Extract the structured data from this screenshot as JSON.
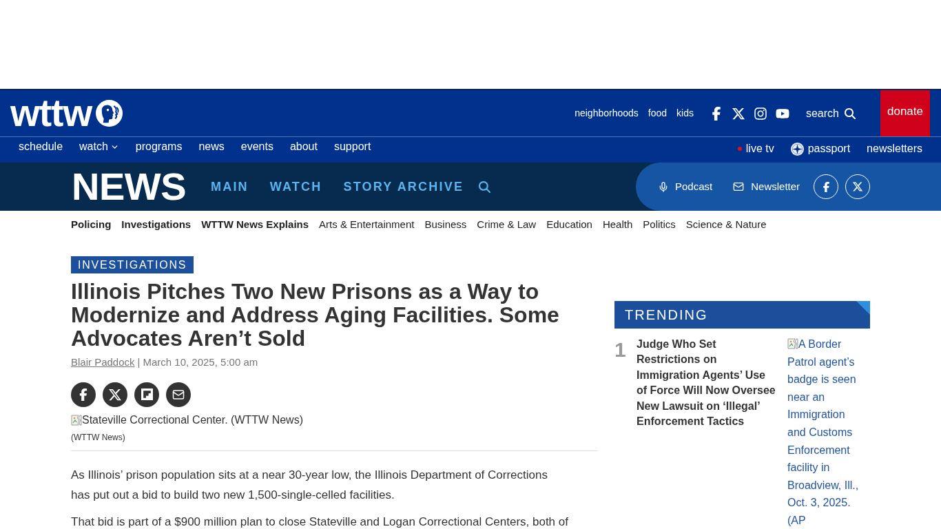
{
  "header": {
    "logo": "wttw",
    "top_links": [
      "neighborhoods",
      "food",
      "kids"
    ],
    "search": "search",
    "donate": "donate",
    "nav": [
      {
        "label": "schedule",
        "dropdown": false
      },
      {
        "label": "watch",
        "dropdown": true
      },
      {
        "label": "programs",
        "dropdown": false
      },
      {
        "label": "news",
        "dropdown": false
      },
      {
        "label": "events",
        "dropdown": false
      },
      {
        "label": "about",
        "dropdown": false
      },
      {
        "label": "support",
        "dropdown": false
      }
    ],
    "utility_links": [
      {
        "label": "live tv",
        "kind": "live"
      },
      {
        "label": "passport",
        "kind": "passport"
      },
      {
        "label": "newsletters",
        "kind": "plain"
      }
    ]
  },
  "news_bar": {
    "logo": "NEWS",
    "links": [
      "MAIN",
      "WATCH",
      "STORY ARCHIVE"
    ],
    "actions": [
      {
        "label": "Podcast",
        "kind": "podcast"
      },
      {
        "label": "Newsletter",
        "kind": "newsletter"
      }
    ]
  },
  "categories": [
    {
      "label": "Policing",
      "emphasized": true
    },
    {
      "label": "Investigations",
      "emphasized": true
    },
    {
      "label": "WTTW News Explains",
      "emphasized": true
    },
    {
      "label": "Arts & Entertainment",
      "emphasized": false
    },
    {
      "label": "Business",
      "emphasized": false
    },
    {
      "label": "Crime & Law",
      "emphasized": false
    },
    {
      "label": "Education",
      "emphasized": false
    },
    {
      "label": "Health",
      "emphasized": false
    },
    {
      "label": "Politics",
      "emphasized": false
    },
    {
      "label": "Science & Nature",
      "emphasized": false
    }
  ],
  "article": {
    "section": "INVESTIGATIONS",
    "headline": "Illinois Pitches Two New Prisons as a Way to Modernize and Address Aging Facilities. Some Advocates Aren’t Sold",
    "author": "Blair Paddock",
    "separator": "|",
    "date": "March 10, 2025, 5:00 am",
    "image_alt": "Stateville Correctional Center. (WTTW News)",
    "image_credit": "(WTTW News)",
    "paragraphs": [
      "As Illinois’ prison population sits at a near 30-year low, the Illinois Department of Corrections has put out a bid to build two new 1,500-single-celled facilities.",
      "That bid is part of a $900 million plan to close Stateville and Logan Correctional Centers, both of"
    ]
  },
  "trending": {
    "title": "TRENDING",
    "items": [
      {
        "rank": "1",
        "title": "Judge Who Set Restrictions on Immigration Agents’ Use of Force Will Now Oversee New Lawsuit on ‘Illegal’ Enforcement Tactics",
        "image_alt": "A Border Patrol agent’s badge is seen near an Immigration and Customs Enforcement facility in Broadview, Ill., Oct. 3, 2025. (AP"
      }
    ]
  }
}
